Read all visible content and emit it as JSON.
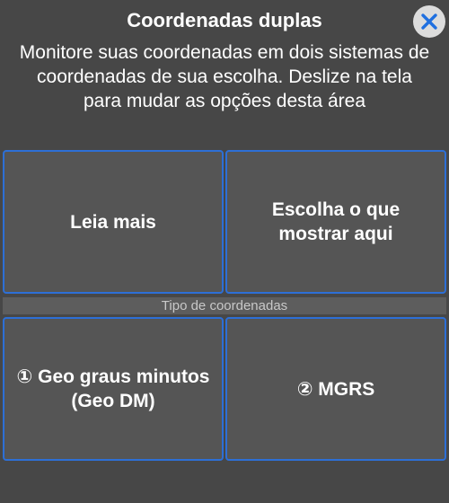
{
  "dialog": {
    "title": "Coordenadas duplas",
    "description": "Monitore suas coordenadas em dois sistemas de coordenadas de sua escolha. Deslize na tela para mudar as opções desta área",
    "close_icon": "close-x-icon",
    "colors": {
      "accent": "#2d6fd6",
      "close_bg": "#dcdcdc",
      "overlay": "#484848",
      "tile_bg": "#555555"
    }
  },
  "tiles": {
    "read_more": "Leia mais",
    "choose_display": "Escolha o que mostrar aqui"
  },
  "section": {
    "label": "Tipo de coordenadas"
  },
  "coordinate_systems": {
    "first": "① Geo graus minutos (Geo DM)",
    "second": "② MGRS"
  }
}
